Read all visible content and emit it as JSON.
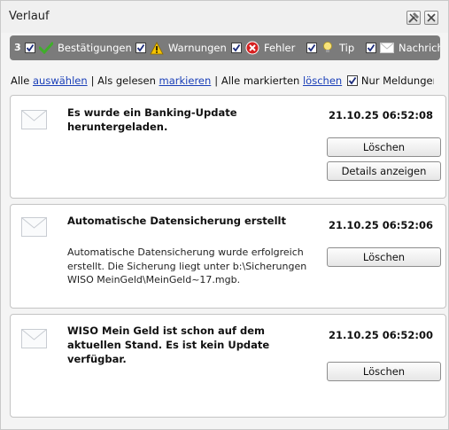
{
  "window": {
    "title": "Verlauf"
  },
  "filters": {
    "count": "3",
    "items": [
      {
        "label": "Bestätigungen",
        "icon": "checkmark-icon",
        "checked": true
      },
      {
        "label": "Warnungen",
        "icon": "warning-icon",
        "checked": true
      },
      {
        "label": "Fehler",
        "icon": "error-icon",
        "checked": true
      },
      {
        "label": "Tip",
        "icon": "lightbulb-icon",
        "checked": true
      },
      {
        "label": "Nachricht",
        "icon": "envelope-icon",
        "checked": true
      }
    ]
  },
  "actions": {
    "all_prefix": "Alle",
    "select_link": "auswählen",
    "read_prefix": "| Als gelesen",
    "mark_link": "markieren",
    "delete_prefix": "| Alle markierten",
    "delete_link": "löschen",
    "only_messages_label": "Nur Meldungen von H",
    "only_messages_checked": true
  },
  "messages": [
    {
      "title": "Es wurde ein Banking-Update heruntergeladen.",
      "timestamp": "21.10.25 06:52:08",
      "body": "",
      "buttons": {
        "delete": "Löschen",
        "details": "Details anzeigen"
      }
    },
    {
      "title": "Automatische Datensicherung erstellt",
      "timestamp": "21.10.25 06:52:06",
      "body": "Automatische Datensicherung wurde erfolgreich erstellt. Die Sicherung liegt unter b:\\Sicherungen WISO MeinGeld\\MeinGeld~17.mgb.",
      "buttons": {
        "delete": "Löschen"
      }
    },
    {
      "title": "WISO Mein Geld ist schon auf dem aktuellen Stand. Es ist kein Update verfügbar.",
      "timestamp": "21.10.25 06:52:00",
      "body": "",
      "buttons": {
        "delete": "Löschen"
      }
    }
  ]
}
